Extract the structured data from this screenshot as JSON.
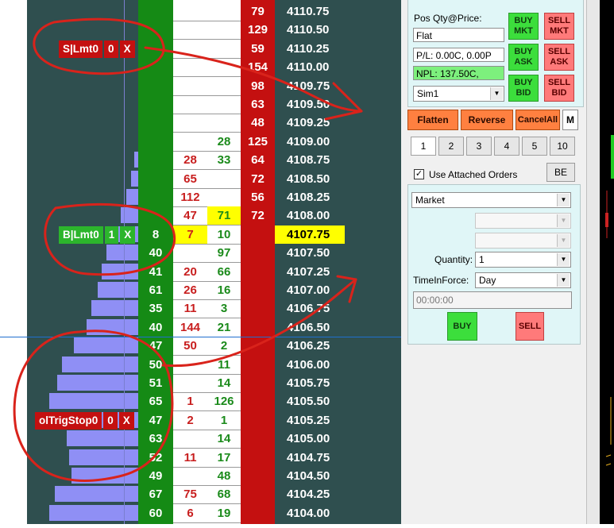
{
  "ladder": {
    "rows": [
      {
        "price": "4110.75",
        "ask_qty": "79",
        "ask": "",
        "bid": "",
        "bid_qty": "",
        "vol": 0
      },
      {
        "price": "4110.50",
        "ask_qty": "129",
        "ask": "",
        "bid": "",
        "bid_qty": "",
        "vol": 0
      },
      {
        "price": "4110.25",
        "ask_qty": "59",
        "ask": "",
        "bid": "",
        "bid_qty": "",
        "vol": 0
      },
      {
        "price": "4110.00",
        "ask_qty": "154",
        "ask": "",
        "bid": "",
        "bid_qty": "",
        "vol": 0
      },
      {
        "price": "4109.75",
        "ask_qty": "98",
        "ask": "",
        "bid": "",
        "bid_qty": "",
        "vol": 0
      },
      {
        "price": "4109.50",
        "ask_qty": "63",
        "ask": "",
        "bid": "",
        "bid_qty": "",
        "vol": 0
      },
      {
        "price": "4109.25",
        "ask_qty": "48",
        "ask": "",
        "bid": "",
        "bid_qty": "",
        "vol": 0
      },
      {
        "price": "4109.00",
        "ask_qty": "125",
        "ask": "28",
        "bid": "",
        "bid_qty": "",
        "vol": 0
      },
      {
        "price": "4108.75",
        "ask_qty": "64",
        "ask": "33",
        "bid": "28",
        "bid_qty": "",
        "vol": 3
      },
      {
        "price": "4108.50",
        "ask_qty": "72",
        "ask": "",
        "bid": "65",
        "bid_qty": "",
        "vol": 6
      },
      {
        "price": "4108.25",
        "ask_qty": "56",
        "ask": "",
        "bid": "112",
        "bid_qty": "",
        "vol": 10
      },
      {
        "price": "4108.00",
        "ask_qty": "72",
        "ask": "71",
        "bid": "47",
        "bid_qty": "",
        "vol": 14
      },
      {
        "price": "4107.75",
        "ask_qty": "",
        "ask": "10",
        "bid": "7",
        "bid_qty": "8",
        "vol": 22
      },
      {
        "price": "4107.50",
        "ask_qty": "",
        "ask": "97",
        "bid": "",
        "bid_qty": "40",
        "vol": 26
      },
      {
        "price": "4107.25",
        "ask_qty": "",
        "ask": "66",
        "bid": "20",
        "bid_qty": "41",
        "vol": 30
      },
      {
        "price": "4107.00",
        "ask_qty": "",
        "ask": "16",
        "bid": "26",
        "bid_qty": "61",
        "vol": 33
      },
      {
        "price": "4106.75",
        "ask_qty": "",
        "ask": "3",
        "bid": "11",
        "bid_qty": "35",
        "vol": 38
      },
      {
        "price": "4106.50",
        "ask_qty": "",
        "ask": "21",
        "bid": "144",
        "bid_qty": "40",
        "vol": 42
      },
      {
        "price": "4106.25",
        "ask_qty": "",
        "ask": "2",
        "bid": "50",
        "bid_qty": "47",
        "vol": 52
      },
      {
        "price": "4106.00",
        "ask_qty": "",
        "ask": "11",
        "bid": "",
        "bid_qty": "50",
        "vol": 62
      },
      {
        "price": "4105.75",
        "ask_qty": "",
        "ask": "14",
        "bid": "",
        "bid_qty": "51",
        "vol": 66
      },
      {
        "price": "4105.50",
        "ask_qty": "",
        "ask": "126",
        "bid": "1",
        "bid_qty": "65",
        "vol": 72
      },
      {
        "price": "4105.25",
        "ask_qty": "",
        "ask": "1",
        "bid": "2",
        "bid_qty": "47",
        "vol": 78
      },
      {
        "price": "4105.00",
        "ask_qty": "",
        "ask": "14",
        "bid": "",
        "bid_qty": "63",
        "vol": 58
      },
      {
        "price": "4104.75",
        "ask_qty": "",
        "ask": "17",
        "bid": "11",
        "bid_qty": "52",
        "vol": 56
      },
      {
        "price": "4104.50",
        "ask_qty": "",
        "ask": "48",
        "bid": "",
        "bid_qty": "49",
        "vol": 54
      },
      {
        "price": "4104.25",
        "ask_qty": "",
        "ask": "68",
        "bid": "75",
        "bid_qty": "67",
        "vol": 68
      },
      {
        "price": "4104.00",
        "ask_qty": "",
        "ask": "19",
        "bid": "6",
        "bid_qty": "60",
        "vol": 72
      }
    ],
    "current_price_index": 12,
    "orders": [
      {
        "type": "S|Lmt0",
        "qty": "0",
        "close": "X",
        "side": "sell",
        "row": 2
      },
      {
        "type": "B|Lmt0",
        "qty": "1",
        "close": "X",
        "side": "buy",
        "row": 12
      },
      {
        "type": "olTrigStop0",
        "qty": "0",
        "close": "X",
        "side": "sell",
        "row": 22
      }
    ]
  },
  "panel": {
    "pos_label": "Pos Qty@Price:",
    "pos_value": "Flat",
    "pl_value": "P/L: 0.00C, 0.00P",
    "npl_value": "NPL: 137.50C,",
    "account": "Sim1",
    "buy_mkt": [
      "BUY",
      "MKT"
    ],
    "sell_mkt": [
      "SELL",
      "MKT"
    ],
    "buy_ask": [
      "BUY",
      "ASK"
    ],
    "sell_ask": [
      "SELL",
      "ASK"
    ],
    "buy_bid": [
      "BUY",
      "BID"
    ],
    "sell_bid": [
      "SELL",
      "BID"
    ],
    "flatten": "Flatten",
    "reverse": "Reverse",
    "cancel_all": "CancelAll",
    "m": "M",
    "qty_tabs": [
      "1",
      "2",
      "3",
      "4",
      "5",
      "10"
    ],
    "use_attached_label": "Use Attached Orders",
    "be": "BE",
    "order_type": "Market",
    "quantity_label": "Quantity:",
    "quantity_value": "1",
    "tif_label": "TimeInForce:",
    "tif_value": "Day",
    "time_value": "00:00:00",
    "buy": "BUY",
    "sell": "SELL"
  },
  "colors": {
    "bid_qty_bg": "#158a15",
    "ask_qty_bg": "#c41010",
    "price_bg": "#2f4f4f",
    "current_price": "#ffff00",
    "annotation": "#d9231b"
  }
}
